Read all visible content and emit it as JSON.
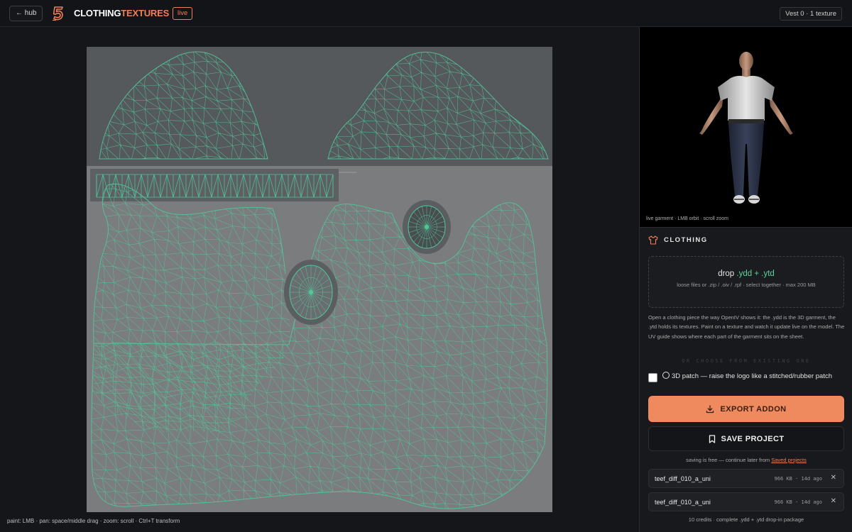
{
  "topbar": {
    "hub_label": "← hub",
    "brand_part1": "CLOTHING",
    "brand_part2": "TEXTURES",
    "live_label": "live",
    "vest_info": "Vest 0 · 1 texture",
    "accent_color": "#ef7f55"
  },
  "canvas": {
    "hint": "paint: LMB · pan: space/middle drag · zoom: scroll · Ctrl+T transform"
  },
  "preview": {
    "caption": "live garment · LMB orbit · scroll zoom"
  },
  "clothing": {
    "section_title": "CLOTHING",
    "drop_prefix": "drop ",
    "drop_ext": ".ydd + .ytd",
    "drop_sub": "loose files or .zip / .oiv / .rpf · select together · max 200 MB",
    "description": "Open a clothing piece the way OpenIV shows it: the .ydd is the 3D garment, the .ytd holds its textures. Paint on a texture and watch it update live on the model. The UV guide shows where each part of the garment sits on the sheet.",
    "or_choose": "OR CHOOSE FROM EXISTING ONE",
    "patch_label": "3D patch — raise the logo like a stitched/rubber patch",
    "patch_checked": false,
    "export_label": "EXPORT ADDON",
    "save_label": "SAVE PROJECT",
    "save_note_prefix": "saving is free — continue later from ",
    "save_note_link": "Saved projects",
    "files": [
      {
        "name": "teef_diff_010_a_uni",
        "size": "966 KB",
        "age": "14d ago"
      },
      {
        "name": "teef_diff_010_a_uni",
        "size": "966 KB",
        "age": "14d ago"
      }
    ],
    "credits": "10 credits · complete .ydd + .ytd drop-in package"
  }
}
